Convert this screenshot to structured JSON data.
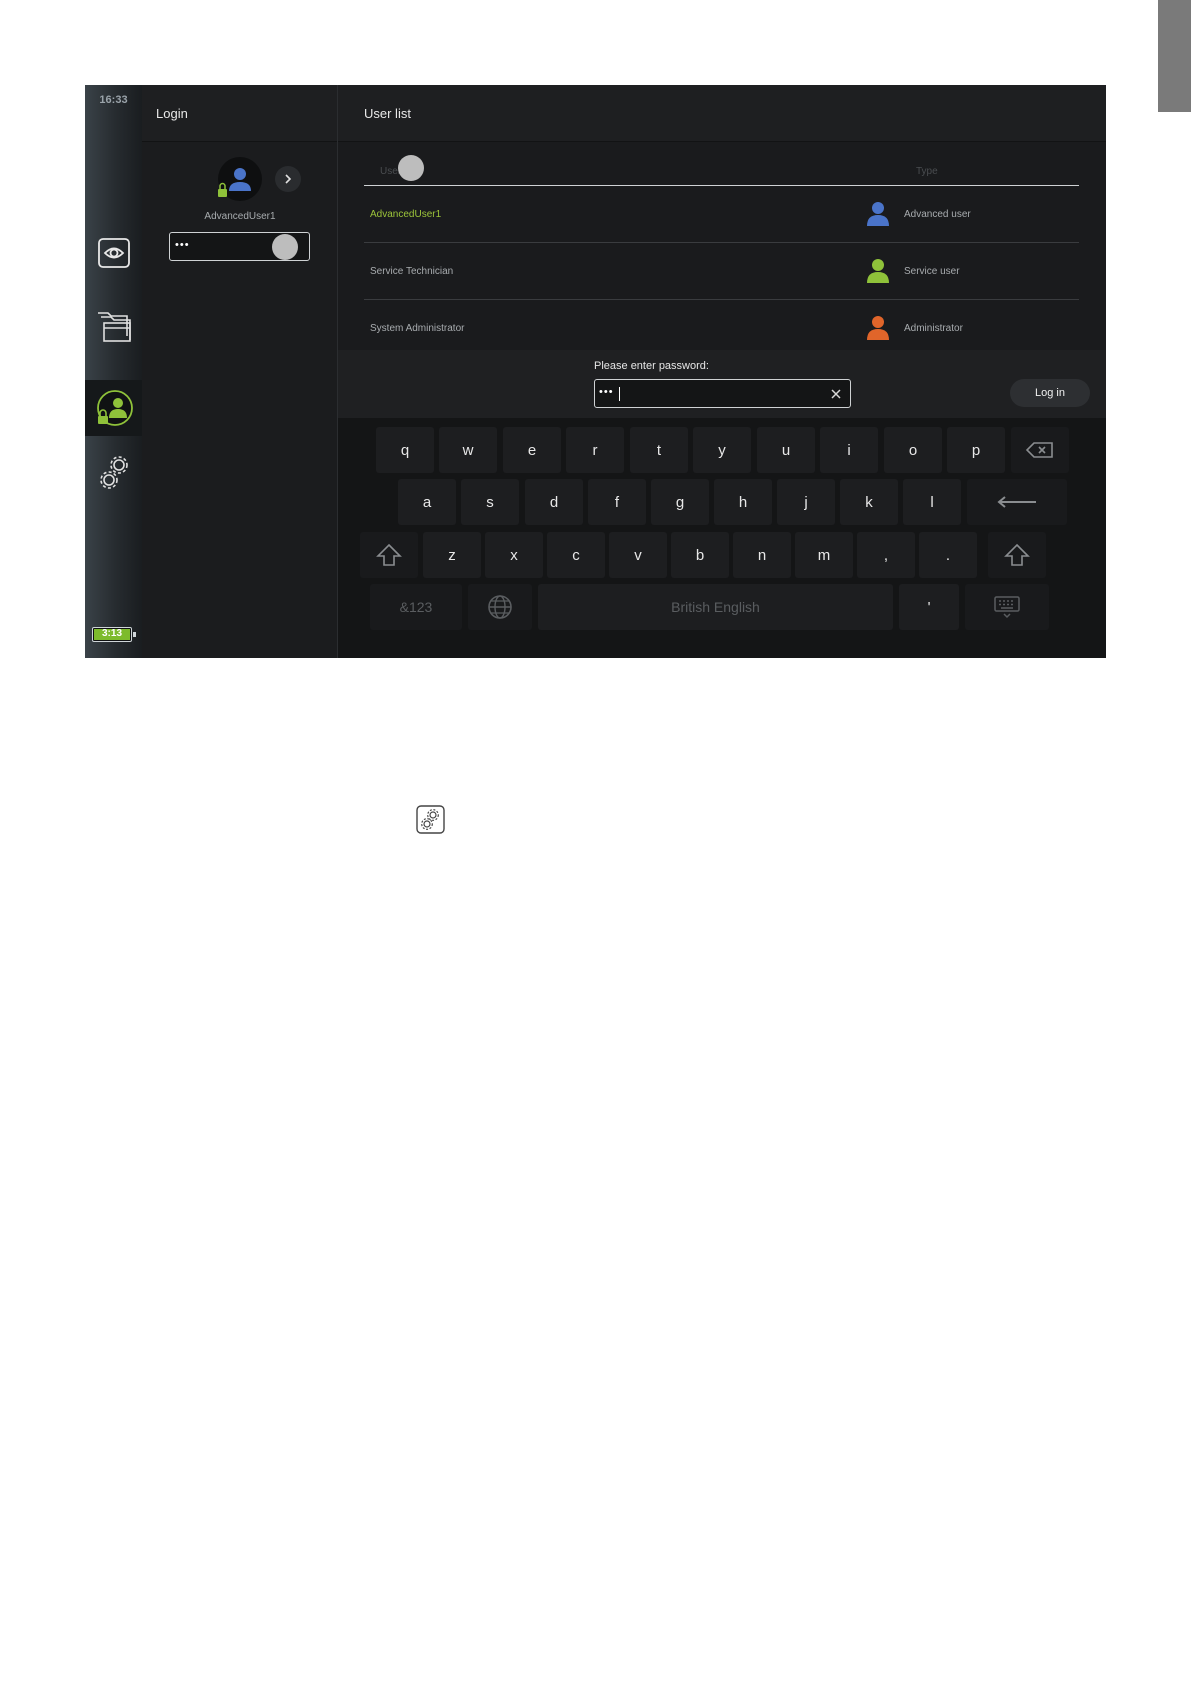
{
  "status": {
    "clock": "16:33",
    "battery": "3:13"
  },
  "nav": {
    "items": [
      {
        "id": "live-view",
        "icon": "eye-icon"
      },
      {
        "id": "archive",
        "icon": "folders-icon"
      },
      {
        "id": "login",
        "icon": "user-lock-icon",
        "active": true
      },
      {
        "id": "settings",
        "icon": "gears-icon"
      }
    ]
  },
  "login_panel": {
    "title": "Login",
    "username": "AdvancedUser1",
    "password_mask": "•••"
  },
  "user_list": {
    "title": "User list",
    "columns": {
      "user": "User",
      "type": "Type"
    },
    "rows": [
      {
        "name": "AdvancedUser1",
        "type": "Advanced user",
        "icon_color": "#4a74c9",
        "selected": true
      },
      {
        "name": "Service Technician",
        "type": "Service user",
        "icon_color": "#8fc23a",
        "selected": false
      },
      {
        "name": "System Administrator",
        "type": "Administrator",
        "icon_color": "#e0652a",
        "selected": false
      }
    ]
  },
  "password_prompt": {
    "label": "Please enter password:",
    "value_mask": "•••",
    "login_button": "Log in"
  },
  "keyboard": {
    "row1": [
      "q",
      "w",
      "e",
      "r",
      "t",
      "y",
      "u",
      "i",
      "o",
      "p"
    ],
    "row2": [
      "a",
      "s",
      "d",
      "f",
      "g",
      "h",
      "j",
      "k",
      "l"
    ],
    "row3": [
      "z",
      "x",
      "c",
      "v",
      "b",
      "n",
      "m",
      ",",
      "."
    ],
    "symbols_key": "&123",
    "space_label": "British English",
    "apostrophe": "'"
  },
  "colors": {
    "accent_green": "#8fc23a",
    "advanced_blue": "#4a74c9",
    "admin_orange": "#e0652a"
  }
}
